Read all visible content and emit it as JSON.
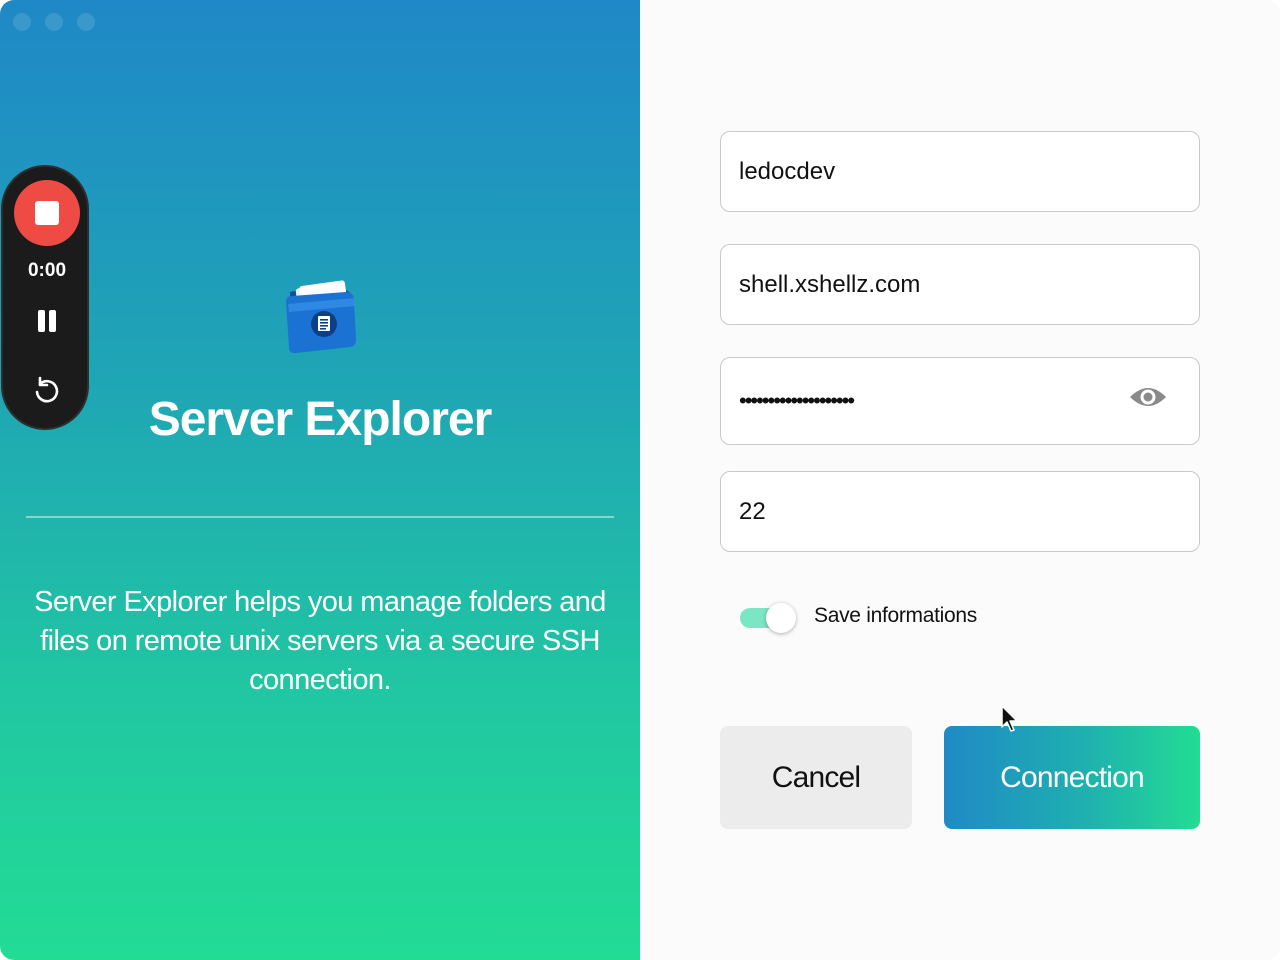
{
  "left": {
    "app_icon": "folder-document-icon",
    "title": "Server Explorer",
    "description": "Server Explorer helps you manage folders and files on remote unix servers via a secure SSH connection."
  },
  "recorder": {
    "time": "0:00",
    "stop_icon": "stop-icon",
    "pause_icon": "pause-icon",
    "restart_icon": "restart-icon"
  },
  "form": {
    "username": "ledocdev",
    "host": "shell.xshellz.com",
    "password_masked": "••••••••••••••••••••",
    "port": "22",
    "save_label": "Save informations",
    "save_enabled": true
  },
  "buttons": {
    "cancel": "Cancel",
    "connect": "Connection"
  },
  "colors": {
    "gradient_top": "#1f88c7",
    "gradient_bottom": "#22dc95",
    "record": "#ef4b45",
    "toggle_on": "#7be6c4"
  }
}
